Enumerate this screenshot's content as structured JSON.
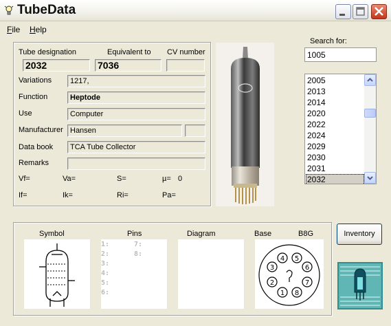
{
  "window": {
    "title": "TubeData"
  },
  "menu": [
    {
      "label": "File",
      "u": "F",
      "rest": "ile"
    },
    {
      "label": "Help",
      "u": "H",
      "rest": "elp"
    }
  ],
  "details": {
    "tube_designation_label": "Tube designation",
    "equivalent_label": "Equivalent to",
    "cv_label": "CV number",
    "tube_designation": "2032",
    "equivalent": "7036",
    "cv_number": "",
    "variations_label": "Variations",
    "variations": "1217,",
    "function_label": "Function",
    "function": "Heptode",
    "use_label": "Use",
    "use": "Computer",
    "manufacturer_label": "Manufacturer",
    "manufacturer": "Hansen",
    "manufacturer_extra": "",
    "databook_label": "Data book",
    "databook": "TCA Tube Collector",
    "remarks_label": "Remarks",
    "remarks": ""
  },
  "params": {
    "vf": "Vf=",
    "va": "Va=",
    "s": "S=",
    "mu": "µ=",
    "mu_val": "0",
    "if": "If=",
    "ik": "Ik=",
    "ri": "Ri=",
    "pa": "Pa="
  },
  "search": {
    "label": "Search for:",
    "value": "1005"
  },
  "list": {
    "items": [
      "2005",
      "2013",
      "2014",
      "2020",
      "2022",
      "2024",
      "2029",
      "2030",
      "2031",
      "2032"
    ],
    "selected": "2032"
  },
  "lower": {
    "symbol_label": "Symbol",
    "pins_label": "Pins",
    "diagram_label": "Diagram",
    "base_label": "Base",
    "base_type": "B8G",
    "pins_left": [
      "1:",
      "2:",
      "3:",
      "4:",
      "5:",
      "6:"
    ],
    "pins_right": [
      "7:",
      "8:"
    ]
  },
  "buttons": {
    "inventory": "Inventory"
  },
  "icons": {
    "app": "lightbulb-icon",
    "minimize": "minimize-icon",
    "maximize": "maximize-icon",
    "close": "close-icon",
    "up": "arrow-up-icon",
    "down": "arrow-down-icon"
  },
  "colors": {
    "close_button": "#c2361a",
    "list_border": "#7f9db9",
    "button_border": "#003c74"
  }
}
